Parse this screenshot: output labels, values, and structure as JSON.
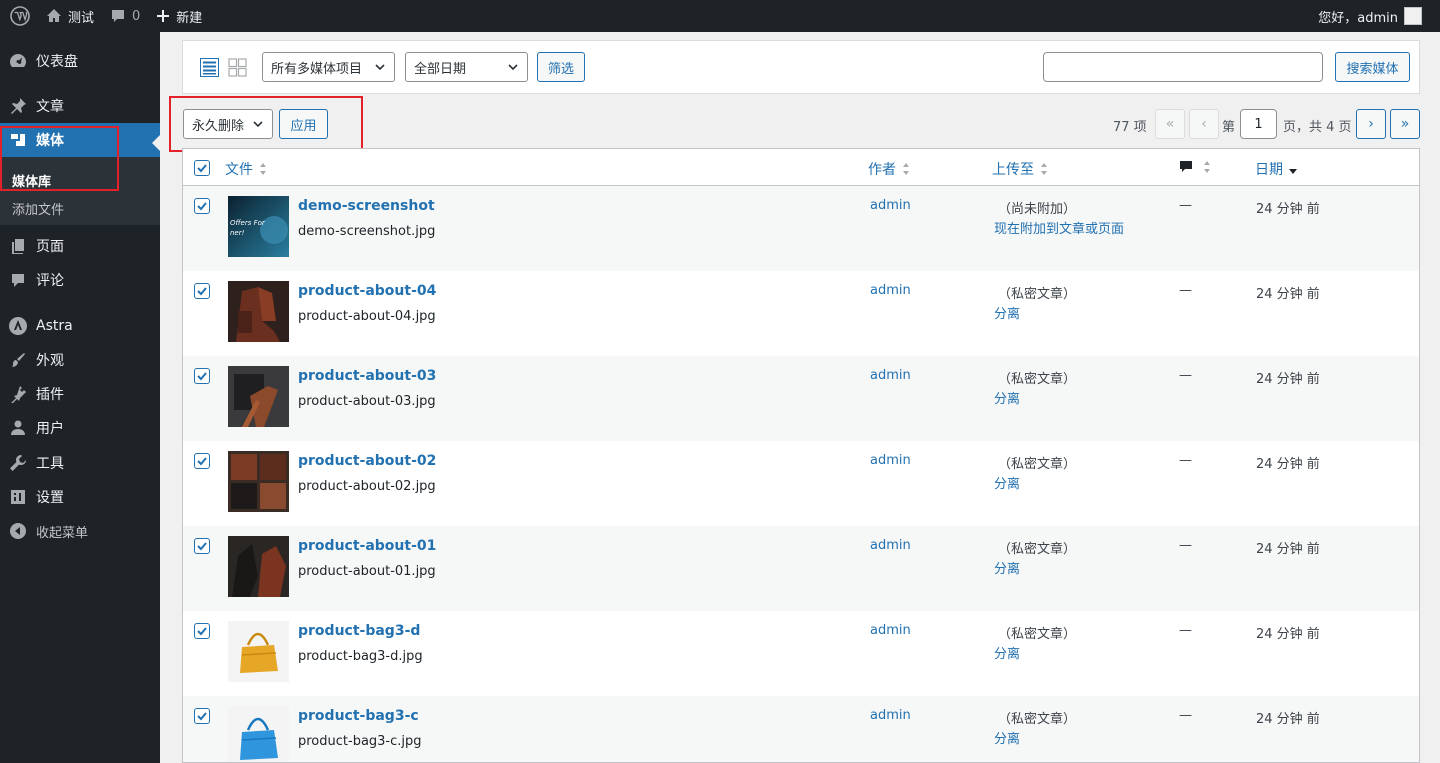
{
  "adminbar": {
    "site_name": "测试",
    "comments_count": "0",
    "new_label": "新建",
    "greeting": "您好，admin"
  },
  "sidebar": {
    "dashboard": "仪表盘",
    "posts": "文章",
    "media": "媒体",
    "media_library": "媒体库",
    "add_file": "添加文件",
    "pages": "页面",
    "comments": "评论",
    "astra": "Astra",
    "appearance": "外观",
    "plugins": "插件",
    "users": "用户",
    "tools": "工具",
    "settings": "设置",
    "collapse": "收起菜单"
  },
  "filters": {
    "media_type": "所有多媒体项目",
    "date": "全部日期",
    "filter_button": "筛选",
    "search_button": "搜索媒体",
    "search_value": ""
  },
  "bulk": {
    "action": "永久删除",
    "apply": "应用"
  },
  "pagination": {
    "items": "77 项",
    "first": "«",
    "prev": "‹",
    "page_prefix": "第",
    "current_page": "1",
    "page_suffix": "页，共 4 页",
    "next": "›",
    "last": "»"
  },
  "table": {
    "headers": {
      "file": "文件",
      "author": "作者",
      "uploaded_to": "上传至",
      "date": "日期"
    },
    "rows": [
      {
        "title": "demo-screenshot",
        "filename": "demo-screenshot.jpg",
        "author": "admin",
        "attach1": "（尚未附加）",
        "attach2": "现在附加到文章或页面",
        "comments": "—",
        "date": "24 分钟 前"
      },
      {
        "title": "product-about-04",
        "filename": "product-about-04.jpg",
        "author": "admin",
        "attach1": "（私密文章）",
        "attach2": "分离",
        "comments": "—",
        "date": "24 分钟 前"
      },
      {
        "title": "product-about-03",
        "filename": "product-about-03.jpg",
        "author": "admin",
        "attach1": "（私密文章）",
        "attach2": "分离",
        "comments": "—",
        "date": "24 分钟 前"
      },
      {
        "title": "product-about-02",
        "filename": "product-about-02.jpg",
        "author": "admin",
        "attach1": "（私密文章）",
        "attach2": "分离",
        "comments": "—",
        "date": "24 分钟 前"
      },
      {
        "title": "product-about-01",
        "filename": "product-about-01.jpg",
        "author": "admin",
        "attach1": "（私密文章）",
        "attach2": "分离",
        "comments": "—",
        "date": "24 分钟 前"
      },
      {
        "title": "product-bag3-d",
        "filename": "product-bag3-d.jpg",
        "author": "admin",
        "attach1": "（私密文章）",
        "attach2": "分离",
        "comments": "—",
        "date": "24 分钟 前"
      },
      {
        "title": "product-bag3-c",
        "filename": "product-bag3-c.jpg",
        "author": "admin",
        "attach1": "（私密文章）",
        "attach2": "分离",
        "comments": "—",
        "date": "24 分钟 前"
      }
    ]
  },
  "thumb_content": {
    "demo_text": "Offers For ner!"
  },
  "colors": {
    "admin_bg": "#1d2327",
    "accent": "#2271b1",
    "highlight_box": "#e3212a"
  }
}
